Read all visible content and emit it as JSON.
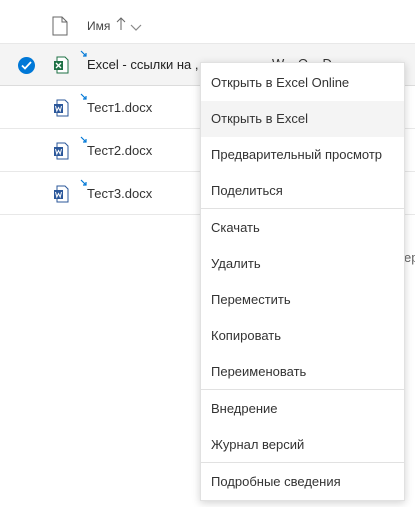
{
  "header": {
    "name_column_label": "Имя",
    "sort_indicator": "↑",
    "file_type_icon": "document-icon",
    "chevron_icon": "chevron-down-icon"
  },
  "files": [
    {
      "name": "Excel - ссылки на ,",
      "icon": "excel-icon",
      "selected": true
    },
    {
      "name": "Тест1.docx",
      "icon": "word-icon",
      "selected": false
    },
    {
      "name": "Тест2.docx",
      "icon": "word-icon",
      "selected": false
    },
    {
      "name": "Тест3.docx",
      "icon": "word-icon",
      "selected": false
    }
  ],
  "obscured_row_text": "W... O... D...",
  "right_edge_fragment": "ер",
  "context_menu": {
    "items": [
      "Открыть в Excel Online",
      "Открыть в Excel",
      "Предварительный просмотр",
      "Поделиться",
      "Скачать",
      "Удалить",
      "Переместить",
      "Копировать",
      "Переименовать",
      "Внедрение",
      "Журнал версий",
      "Подробные сведения"
    ],
    "hovered_item": "Открыть в Excel"
  },
  "colors": {
    "accent": "#0078d7",
    "excel_green": "#1e7145",
    "word_blue": "#2b579a"
  }
}
